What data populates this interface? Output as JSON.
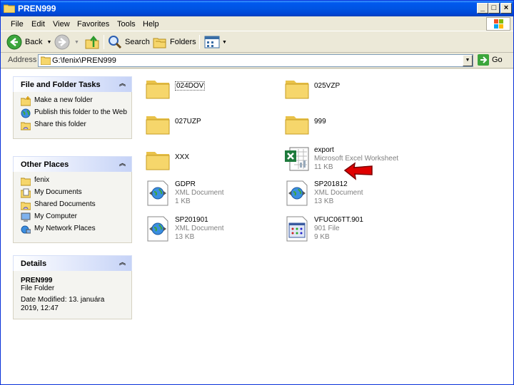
{
  "window": {
    "title": "PREN999"
  },
  "menu": [
    "File",
    "Edit",
    "View",
    "Favorites",
    "Tools",
    "Help"
  ],
  "toolbar": {
    "back_label": "Back",
    "search_label": "Search",
    "folders_label": "Folders"
  },
  "address": {
    "label": "Address",
    "value": "G:\\fenix\\PREN999",
    "go_label": "Go"
  },
  "tasks": {
    "title": "File and Folder Tasks",
    "items": [
      "Make a new folder",
      "Publish this folder to the Web",
      "Share this folder"
    ]
  },
  "places": {
    "title": "Other Places",
    "items": [
      "fenix",
      "My Documents",
      "Shared Documents",
      "My Computer",
      "My Network Places"
    ]
  },
  "details": {
    "title": "Details",
    "name": "PREN999",
    "type": "File Folder",
    "modified": "Date Modified: 13. januára 2019, 12:47"
  },
  "files": [
    {
      "name": "024DOV",
      "kind": "folder"
    },
    {
      "name": "025VZP",
      "kind": "folder"
    },
    {
      "name": "027UZP",
      "kind": "folder"
    },
    {
      "name": "999",
      "kind": "folder"
    },
    {
      "name": "XXX",
      "kind": "folder"
    },
    {
      "name": "export",
      "kind": "excel",
      "type": "Microsoft Excel Worksheet",
      "size": "11 KB"
    },
    {
      "name": "GDPR",
      "kind": "xml",
      "type": "XML Document",
      "size": "1 KB"
    },
    {
      "name": "SP201812",
      "kind": "xml",
      "type": "XML Document",
      "size": "13 KB"
    },
    {
      "name": "SP201901",
      "kind": "xml",
      "type": "XML Document",
      "size": "13 KB"
    },
    {
      "name": "VFUC06TT.901",
      "kind": "file901",
      "type": "901 File",
      "size": "9 KB"
    }
  ],
  "colors": {
    "titlebar": "#0054e3",
    "accent_arrow": "#e00000",
    "folder": "#f6d66b"
  }
}
